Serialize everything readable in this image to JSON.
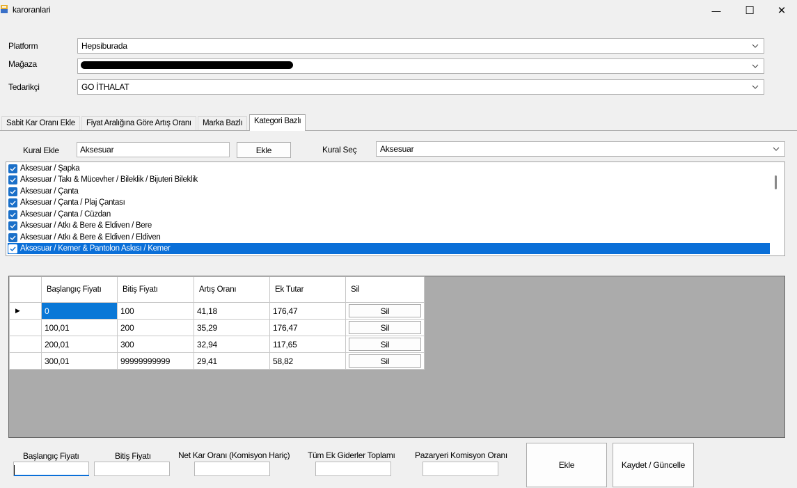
{
  "window": {
    "title": "karoranlari",
    "controls": {
      "minimize": "—",
      "maximize": "☐",
      "close": "✕"
    }
  },
  "form": {
    "platform": {
      "label": "Platform",
      "value": "Hepsiburada"
    },
    "store": {
      "label": "Mağaza",
      "value": ""
    },
    "supplier": {
      "label": "Tedarikçi",
      "value": "GO İTHALAT"
    }
  },
  "tabs": [
    {
      "label": "Sabit Kar Oranı Ekle"
    },
    {
      "label": "Fiyat Aralığına Göre Artış Oranı"
    },
    {
      "label": "Marka Bazlı"
    },
    {
      "label": "Kategori Bazlı"
    }
  ],
  "rules": {
    "add_label": "Kural Ekle",
    "add_value": "Aksesuar",
    "add_button": "Ekle",
    "select_label": "Kural Seç",
    "select_value": "Aksesuar"
  },
  "categories": [
    {
      "label": "Aksesuar / Şapka",
      "checked": true
    },
    {
      "label": "Aksesuar / Takı & Mücevher / Bileklik / Bijuteri Bileklik",
      "checked": true
    },
    {
      "label": "Aksesuar / Çanta",
      "checked": true
    },
    {
      "label": "Aksesuar / Çanta / Plaj Çantası",
      "checked": true
    },
    {
      "label": "Aksesuar / Çanta / Cüzdan",
      "checked": true
    },
    {
      "label": "Aksesuar / Atkı & Bere & Eldiven / Bere",
      "checked": true
    },
    {
      "label": "Aksesuar / Atkı & Bere & Eldiven / Eldiven",
      "checked": true
    },
    {
      "label": "Aksesuar / Kemer & Pantolon Askısı / Kemer",
      "checked": true,
      "selected": true
    }
  ],
  "grid": {
    "headers": {
      "start": "Başlangıç Fiyatı",
      "end": "Bitiş Fiyatı",
      "rate": "Artış Oranı",
      "extra": "Ek Tutar",
      "delete": "Sil"
    },
    "rows": [
      {
        "start": "0",
        "end": "100",
        "rate": "41,18",
        "extra": "176,47",
        "delete": "Sil"
      },
      {
        "start": "100,01",
        "end": "200",
        "rate": "35,29",
        "extra": "176,47",
        "delete": "Sil"
      },
      {
        "start": "200,01",
        "end": "300",
        "rate": "32,94",
        "extra": "117,65",
        "delete": "Sil"
      },
      {
        "start": "300,01",
        "end": "99999999999",
        "rate": "29,41",
        "extra": "58,82",
        "delete": "Sil"
      }
    ]
  },
  "bottom": {
    "start_price_label": "Başlangıç Fiyatı",
    "end_price_label": "Bitiş Fiyatı",
    "net_profit_label": "Net Kar Oranı (Komisyon Hariç)",
    "extra_total_label": "Tüm Ek Giderler Toplamı",
    "commission_label": "Pazaryeri Komisyon Oranı",
    "add_button": "Ekle",
    "save_button": "Kaydet / Güncelle"
  }
}
